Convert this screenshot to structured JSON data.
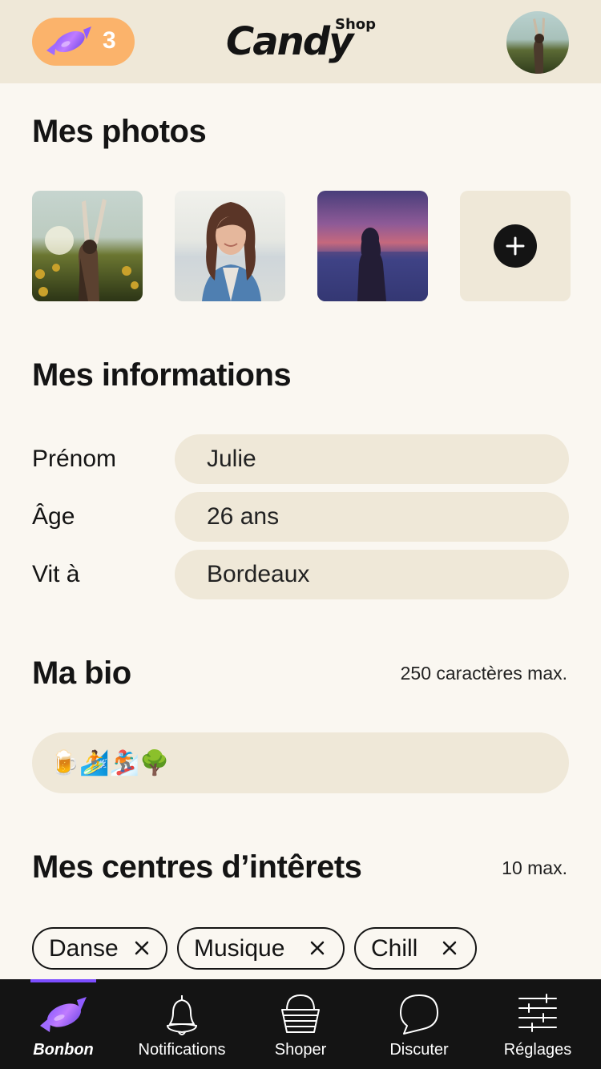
{
  "header": {
    "candy_count": "3",
    "logo_text": "Candy",
    "logo_sub": "Shop",
    "brand_color": "#fbb36b"
  },
  "photos": {
    "title": "Mes photos"
  },
  "info": {
    "title": "Mes informations",
    "fields": [
      {
        "label": "Prénom",
        "value": "Julie"
      },
      {
        "label": "Âge",
        "value": "26 ans"
      },
      {
        "label": "Vit à",
        "value": "Bordeaux"
      }
    ]
  },
  "bio": {
    "title": "Ma bio",
    "note": "250 caractères max.",
    "value": "🍺🏄🏂🌳"
  },
  "interests": {
    "title": "Mes centres d’intêrets",
    "note": "10 max.",
    "chips": [
      "Danse",
      "Musique",
      "Chill"
    ]
  },
  "nav": {
    "accent": "#7c4dff",
    "items": [
      {
        "label": "Bonbon",
        "icon": "candy-icon",
        "active": true
      },
      {
        "label": "Notifications",
        "icon": "bell-icon"
      },
      {
        "label": "Shoper",
        "icon": "basket-icon"
      },
      {
        "label": "Discuter",
        "icon": "chat-icon"
      },
      {
        "label": "Réglages",
        "icon": "sliders-icon"
      }
    ]
  }
}
